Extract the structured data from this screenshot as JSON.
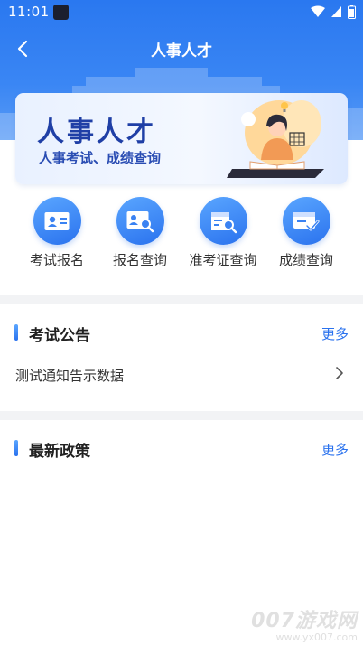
{
  "status_bar": {
    "time": "11:01",
    "icons": [
      "wifi-icon",
      "signal-icon",
      "battery-icon"
    ]
  },
  "nav": {
    "title": "人事人才",
    "back_icon": "chevron-left-icon"
  },
  "banner": {
    "title": "人事人才",
    "subtitle": "人事考试、成绩查询"
  },
  "shortcuts": [
    {
      "label": "考试报名",
      "icon": "id-card-icon"
    },
    {
      "label": "报名查询",
      "icon": "id-search-icon"
    },
    {
      "label": "准考证查询",
      "icon": "ticket-search-icon"
    },
    {
      "label": "成绩查询",
      "icon": "score-check-icon"
    }
  ],
  "exam_notice": {
    "title": "考试公告",
    "more": "更多",
    "items": [
      {
        "text": "测试通知告示数据"
      }
    ]
  },
  "latest_policy": {
    "title": "最新政策",
    "more": "更多"
  },
  "watermark": {
    "line1": "007游戏网",
    "line2": "www.yx007.com"
  },
  "colors": {
    "primary": "#2a72ee",
    "header": "#2a78f0",
    "banner_title": "#1f3fa6"
  }
}
